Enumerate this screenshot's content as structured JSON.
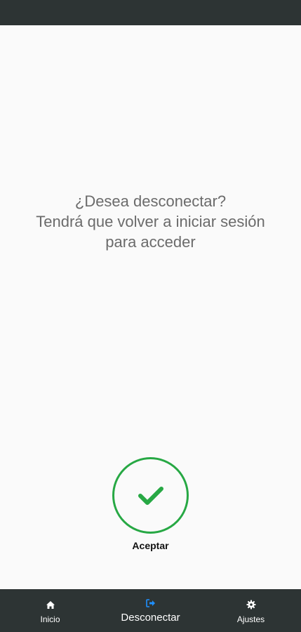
{
  "dialog": {
    "line1": "¿Desea desconectar?",
    "line2": "Tendrá que volver a iniciar sesión",
    "line3": "para acceder"
  },
  "accept": {
    "label": "Aceptar",
    "icon": "check-icon",
    "color": "#27a844"
  },
  "bottom_nav": {
    "items": [
      {
        "label": "Inicio",
        "icon": "home-icon",
        "active": false
      },
      {
        "label": "Desconectar",
        "icon": "logout-icon",
        "active": true
      },
      {
        "label": "Ajustes",
        "icon": "gear-icon",
        "active": false
      }
    ],
    "active_color": "#1e90ff",
    "background": "#2d3434"
  }
}
